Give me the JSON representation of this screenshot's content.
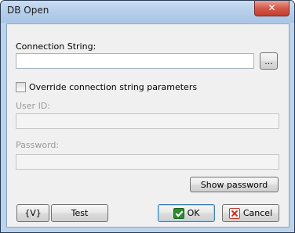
{
  "window": {
    "title": "DB Open",
    "close_glyph": "✕"
  },
  "connection": {
    "label": "Connection String:",
    "value": "",
    "browse_label": "..."
  },
  "override": {
    "label": "Override connection string parameters",
    "checked": false
  },
  "user_id": {
    "label": "User ID:",
    "value": ""
  },
  "password": {
    "label": "Password:",
    "value": ""
  },
  "buttons": {
    "show_password": "Show password",
    "variables": "{V}",
    "test": "Test",
    "ok": "OK",
    "cancel": "Cancel"
  },
  "icons": {
    "ok": "ok-check-icon",
    "cancel": "cancel-x-icon"
  }
}
